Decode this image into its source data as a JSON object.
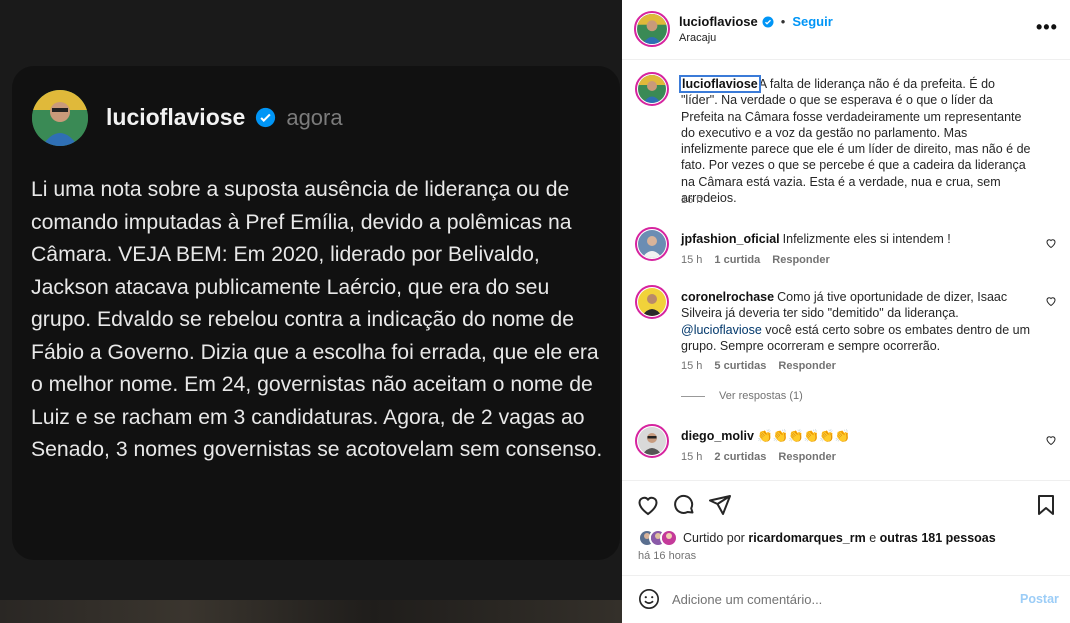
{
  "card": {
    "username": "lucioflaviose",
    "time": "agora",
    "text": "Li uma nota sobre a suposta ausência de liderança ou de comando imputadas à Pref Emília, devido a polêmicas na Câmara. VEJA BEM: Em 2020, liderado por Belivaldo, Jackson atacava publicamente Laércio, que era do seu grupo. Edvaldo se rebelou contra a indicação do nome de Fábio a Governo. Dizia que a escolha foi errada, que ele era o melhor nome. Em 24, governistas não aceitam o nome de Luiz e se racham em 3 candidaturas. Agora, de 2 vagas ao Senado, 3 nomes governistas se acotovelam sem consenso."
  },
  "header": {
    "username": "lucioflaviose",
    "follow_label": "Seguir",
    "separator": "•",
    "location": "Aracaju",
    "more_label": "•••"
  },
  "caption": {
    "username": "lucioflaviose",
    "text": "A falta de liderança não é da prefeita. É do \"líder\". Na verdade o que se esperava é o que o líder da Prefeita na Câmara fosse verdadeiramente um representante do executivo e a voz da gestão no parlamento. Mas infelizmente parece que ele é um líder de direito, mas não é de fato. Por vezes o que se percebe é que a cadeira da liderança na Câmara está vazia. Esta é a verdade, nua e crua, sem arrodeios.",
    "time": "16 h"
  },
  "comments": [
    {
      "username": "jpfashion_oficial",
      "text": "Infelizmente eles si intendem !",
      "time": "15 h",
      "likes": "1 curtida",
      "reply": "Responder"
    },
    {
      "username": "coronelrochase",
      "text": "Como já tive oportunidade de dizer, Isaac Silveira já deveria ter sido \"demitido\" da liderança.",
      "mention": "@lucioflaviose",
      "text2": " você está certo sobre os embates dentro de um grupo. Sempre ocorreram e sempre ocorrerão.",
      "time": "15 h",
      "likes": "5 curtidas",
      "reply": "Responder",
      "view_replies": "Ver respostas (1)"
    },
    {
      "username": "diego_moliv",
      "text": "👏👏👏👏👏👏",
      "time": "15 h",
      "likes": "2 curtidas",
      "reply": "Responder"
    }
  ],
  "likes": {
    "prefix": "Curtido por",
    "user": "ricardomarques_rm",
    "middle": "e",
    "others": "outras 181 pessoas"
  },
  "posted_ago": "há 16 horas",
  "add_comment": {
    "placeholder": "Adicione um comentário...",
    "post_label": "Postar"
  },
  "colors": {
    "accent": "#0095f6",
    "verified": "#0095f6",
    "post_disabled": "#9ccdf7",
    "card_bg": "#111111"
  }
}
